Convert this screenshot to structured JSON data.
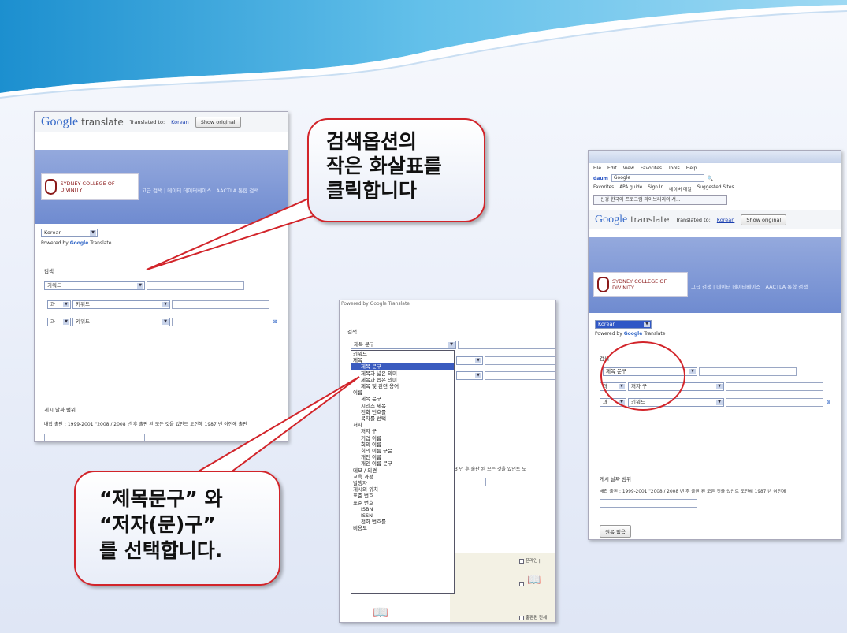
{
  "callouts": {
    "top": "검색옵션의\n작은 화살표를\n클릭합니다",
    "bottom": "“제목문구” 와\n“저자(문)구”\n를 선택합니다."
  },
  "google": {
    "logo": "Google",
    "product": "translate",
    "translated_to": "Translated to:",
    "language": "Korean",
    "show_original": "Show original",
    "powered_by": "Powered by",
    "powered_google": "Google",
    "powered_translate": "Translate"
  },
  "site": {
    "logo_text": "SYDNEY COLLEGE OF DIVINITY",
    "nav_text": "고급 검색 | 데이터 데이터베이스 | AACTLA 통합 검색"
  },
  "shot1": {
    "search_label": "검색",
    "row1_select": "키워드",
    "row2_and": "과",
    "row2_select": "키워드",
    "row3_and": "과",
    "row3_select": "키워드",
    "date_label": "게시 날짜 범위",
    "date_text": "배합 출판 : 1999-2001 \"2008 / 2008 년 후 출판 된 모든 것을 있인트 도전해 1987 년 이전에 출판"
  },
  "shot2": {
    "top_text": "Powered by Google Translate",
    "search_label": "검색",
    "row1_select": "제목 문구",
    "dropdown_items": [
      "키워드",
      "제목",
      "제목 문구",
      "제목과 넓은 의미",
      "제목과 좁은 의미",
      "제목 및 관련 용어",
      "이름",
      "제목 문구",
      "시리즈 제목",
      "전화 번호를",
      "목차를 선택",
      "저자",
      "저자 구",
      "기업 이름",
      "회의 이름",
      "회의 이름 구문",
      "개인 이름",
      "개인 이름 문구",
      "메모 / 의견",
      "교육 과정",
      "발행자",
      "게시의 위치",
      "표준 번호",
      "표준 번호",
      "ISBN",
      "ISSN",
      "전화 번호를",
      "비용도"
    ],
    "dropdown_highlight_index": 2,
    "side_text": "3 년 후 출판 된 모든 것을 있인트 도",
    "cb1": "온라인 |",
    "cb3": "출판된 전체"
  },
  "shot3": {
    "menu": [
      "File",
      "Edit",
      "View",
      "Favorites",
      "Tools",
      "Help"
    ],
    "daum_search": "Google",
    "bookmarks": [
      "Favorites",
      "APA guide",
      "Sign In",
      "네이버 메일",
      "Suggested Sites"
    ],
    "tab_title": "신경 한국어 프로그램 라이브러리의 서...",
    "language": "Korean",
    "search_label": "검색",
    "row1_select": "제목 문구",
    "row2_and": "과",
    "row2_select": "저자 구",
    "row3_and": "과",
    "row3_select": "키워드",
    "date_label": "게시 날짜 범위",
    "date_text": "배합 출판 : 1999-2001 \"2008 / 2008 년 후 출판 된 모든 것을 있인트 도전해 1987 년 이전에",
    "search_button": "원목 없음"
  },
  "colors": {
    "accent_red": "#d2242a",
    "header_blue": "#7a93d4",
    "wave": "#5fb6e6"
  }
}
